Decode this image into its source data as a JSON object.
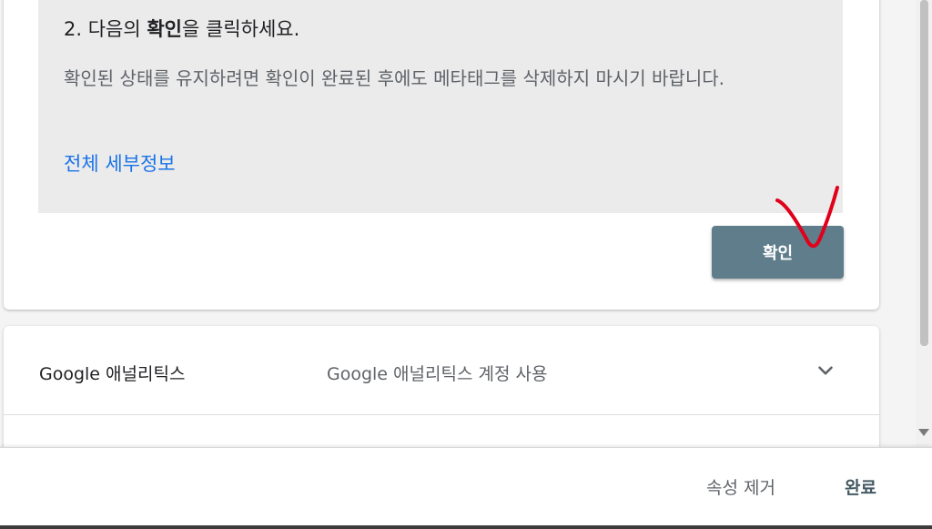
{
  "verify": {
    "title_prefix": "2. 다음의 ",
    "title_bold": "확인",
    "title_suffix": "을 클릭하세요.",
    "description": "확인된 상태를 유지하려면 확인이 완료된 후에도 메타태그를 삭제하지 마시기 바랍니다.",
    "details_link": "전체 세부정보",
    "confirm_button": "확인"
  },
  "analytics": {
    "name": "Google 애널리틱스",
    "description": "Google 애널리틱스 계정 사용",
    "icon": "chevron-down-icon"
  },
  "action_bar": {
    "remove_button": "속성 제거",
    "done_button": "완료"
  },
  "colors": {
    "confirm_button_bg": "#607d8b",
    "link": "#1a73e8",
    "annotation_mark": "#e0001b",
    "done_text": "#455a64"
  }
}
